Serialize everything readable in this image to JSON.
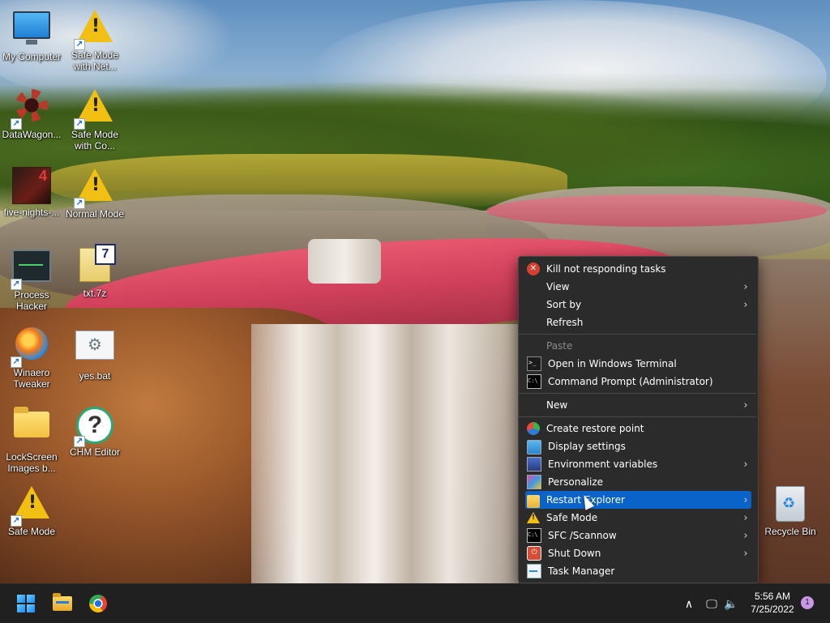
{
  "desktop": {
    "icons": [
      {
        "label": "My Computer",
        "icon": "computer-icon"
      },
      {
        "label": "Safe Mode with Net...",
        "icon": "warning-icon"
      },
      {
        "label": "DataWagon...",
        "icon": "gear-icon"
      },
      {
        "label": "Safe Mode with Co...",
        "icon": "warning-icon"
      },
      {
        "label": "five-nights-...",
        "icon": "game-icon"
      },
      {
        "label": "Normal Mode",
        "icon": "warning-icon"
      },
      {
        "label": "Process Hacker",
        "icon": "process-hacker-icon"
      },
      {
        "label": "txt.7z",
        "icon": "archive-icon"
      },
      {
        "label": "Winaero Tweaker",
        "icon": "winaero-icon"
      },
      {
        "label": "yes.bat",
        "icon": "batch-file-icon"
      },
      {
        "label": "LockScreen Images b...",
        "icon": "folder-icon"
      },
      {
        "label": "CHM Editor",
        "icon": "help-icon"
      },
      {
        "label": "Safe Mode",
        "icon": "warning-icon"
      },
      {
        "label": "Recycle Bin",
        "icon": "recycle-bin-icon"
      }
    ]
  },
  "context_menu": {
    "items": [
      {
        "label": "Kill not responding tasks",
        "icon": "close-circle-icon"
      },
      {
        "label": "View",
        "submenu": true
      },
      {
        "label": "Sort by",
        "submenu": true
      },
      {
        "label": "Refresh"
      },
      {
        "label": "Paste",
        "disabled": true
      },
      {
        "label": "Open in Windows Terminal",
        "icon": "terminal-icon"
      },
      {
        "label": "Command Prompt (Administrator)",
        "icon": "command-prompt-icon"
      },
      {
        "label": "New",
        "submenu": true
      },
      {
        "label": "Create restore point",
        "icon": "restore-point-icon"
      },
      {
        "label": "Display settings",
        "icon": "display-icon"
      },
      {
        "label": "Environment variables",
        "icon": "environment-icon",
        "submenu": true
      },
      {
        "label": "Personalize",
        "icon": "personalize-icon"
      },
      {
        "label": "Restart Explorer",
        "icon": "folder-icon",
        "submenu": true,
        "highlighted": true
      },
      {
        "label": "Safe Mode",
        "icon": "warning-icon",
        "submenu": true
      },
      {
        "label": "SFC /Scannow",
        "icon": "command-prompt-icon",
        "submenu": true
      },
      {
        "label": "Shut Down",
        "icon": "power-icon",
        "submenu": true
      },
      {
        "label": "Task Manager",
        "icon": "task-manager-icon"
      }
    ],
    "icon_glyphs": {
      "kill": "✕",
      "terminal": ">_",
      "cmd": "C:\\",
      "warning": "!",
      "power": "⏻"
    }
  },
  "taskbar": {
    "clock": {
      "time": "5:56 AM",
      "date": "7/25/2022"
    },
    "notification_count": "1",
    "tray_glyphs": {
      "chevron": "∧",
      "network": "🖵",
      "volume": "🔈"
    }
  },
  "colors": {
    "menu_background": "#2b2b2b",
    "menu_highlight": "#0a63c8",
    "taskbar_background": "#202020",
    "accent": "#1a8cf0"
  },
  "glyphs": {
    "submenu_arrow": "›",
    "warning": "!",
    "question": "?",
    "archive": "7",
    "game_number": "4",
    "shortcut": "↗",
    "gears": "⚙",
    "recycle": "♻"
  }
}
